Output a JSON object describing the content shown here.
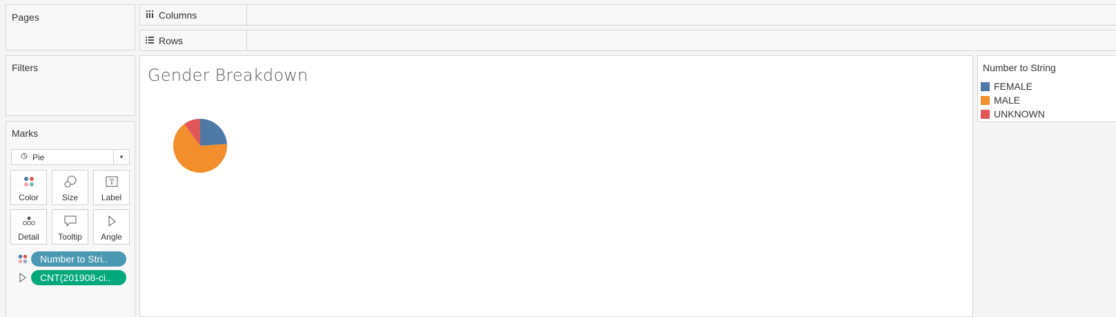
{
  "shelves": {
    "pages_label": "Pages",
    "filters_label": "Filters",
    "columns_label": "Columns",
    "rows_label": "Rows"
  },
  "marks": {
    "title": "Marks",
    "mark_type": "Pie",
    "buttons": {
      "color": "Color",
      "size": "Size",
      "label": "Label",
      "detail": "Detail",
      "tooltip": "Tooltip",
      "angle": "Angle"
    },
    "pills": [
      {
        "text": "Number to Stri..",
        "color": "#4b98b3",
        "role": "color"
      },
      {
        "text": "CNT(201908-ci..",
        "color": "#00a97a",
        "role": "angle"
      }
    ]
  },
  "view": {
    "title": "Gender Breakdown"
  },
  "legend": {
    "title": "Number to String",
    "items": [
      {
        "label": "FEMALE",
        "color": "#4e79a7"
      },
      {
        "label": "MALE",
        "color": "#f28e2b"
      },
      {
        "label": "UNKNOWN",
        "color": "#e15759"
      }
    ]
  },
  "chart_data": {
    "type": "pie",
    "categories": [
      "FEMALE",
      "MALE",
      "UNKNOWN"
    ],
    "values": [
      24,
      66,
      10
    ],
    "colors": [
      "#4e79a7",
      "#f28e2b",
      "#e15759"
    ]
  }
}
